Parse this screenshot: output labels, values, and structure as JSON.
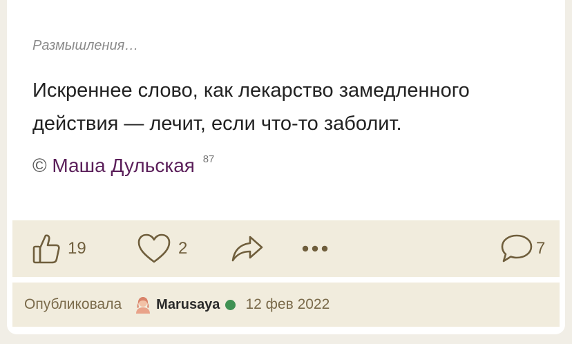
{
  "post": {
    "category": "Размышления…",
    "quote_line1": "Искреннее слово, как лекарство замедленного",
    "quote_line2": "действия — лечит, если что-то заболит.",
    "copyright_symbol": "©",
    "author": "Маша Дульская",
    "author_quote_count": "87"
  },
  "actions": {
    "likes": "19",
    "favorites": "2",
    "comments": "7"
  },
  "meta": {
    "published_label": "Опубликовала",
    "username": "Marusaya",
    "date": "12 фев 2022",
    "online_color": "#3f9152"
  },
  "colors": {
    "page_bg": "#f1eee6",
    "panel_bg": "#f1ecdd",
    "icon_color": "#6f5e3c",
    "author_link": "#5b1f5a"
  },
  "icons": [
    "thumbs-up-icon",
    "heart-icon",
    "share-arrow-icon",
    "more-dots-icon",
    "comment-bubble-icon",
    "user-avatar-icon"
  ]
}
